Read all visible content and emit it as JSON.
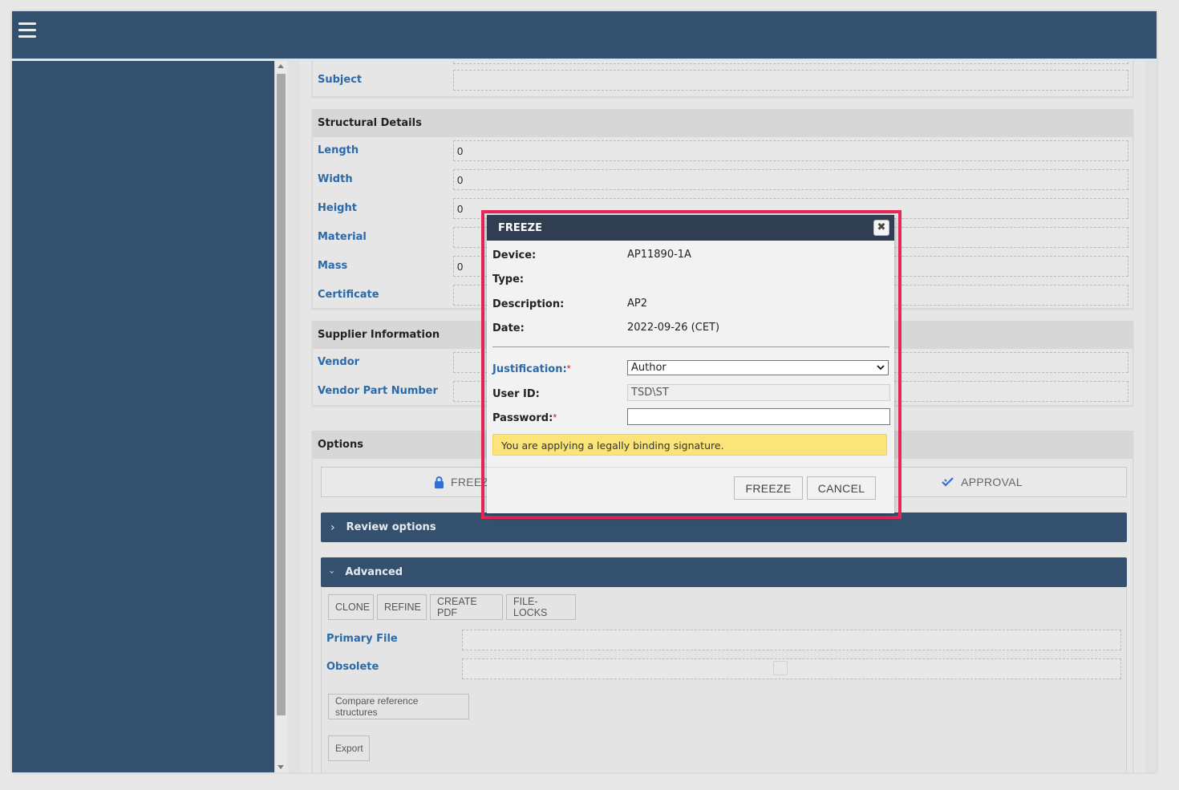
{
  "header": {
    "menu_icon": "hamburger-icon"
  },
  "form": {
    "subject_label": "Subject",
    "structural": {
      "title": "Structural Details",
      "fields": [
        {
          "label": "Length",
          "value": "0"
        },
        {
          "label": "Width",
          "value": "0"
        },
        {
          "label": "Height",
          "value": "0"
        },
        {
          "label": "Material",
          "value": ""
        },
        {
          "label": "Mass",
          "value": "0"
        },
        {
          "label": "Certificate",
          "value": ""
        }
      ]
    },
    "supplier": {
      "title": "Supplier Information",
      "fields": [
        {
          "label": "Vendor",
          "value": ""
        },
        {
          "label": "Vendor Part Number",
          "value": ""
        }
      ]
    },
    "options": {
      "title": "Options",
      "freeze_label": "FREEZE",
      "approval_label": "APPROVAL",
      "review_label": "Review options",
      "advanced_label": "Advanced",
      "buttons": [
        "CLONE",
        "REFINE",
        "CREATE PDF",
        "FILE-LOCKS"
      ],
      "primary_file_label": "Primary File",
      "obsolete_label": "Obsolete",
      "compare_label": "Compare reference structures",
      "export_label": "Export"
    }
  },
  "dialog": {
    "title": "FREEZE",
    "close_icon": "close-icon",
    "device_label": "Device:",
    "device_value": "AP11890-1A",
    "type_label": "Type:",
    "type_value": "",
    "description_label": "Description:",
    "description_value": "AP2",
    "date_label": "Date:",
    "date_value": "2022-09-26 (CET)",
    "justification_label": "Justification:",
    "justification_value": "Author",
    "userid_label": "User ID:",
    "userid_value": "TSD\\ST",
    "password_label": "Password:",
    "password_value": "",
    "warning": "You are applying a legally binding signature.",
    "freeze_button": "FREEZE",
    "cancel_button": "CANCEL"
  },
  "colors": {
    "nav": "#34506f",
    "dialog_header": "#2f3f51",
    "highlight_border": "#e8275a",
    "warning_bg": "#fbe57a",
    "label_blue": "#2b6aa8",
    "freeze_lock": "#2f6fd6",
    "approval_check": "#2f6fd6"
  }
}
